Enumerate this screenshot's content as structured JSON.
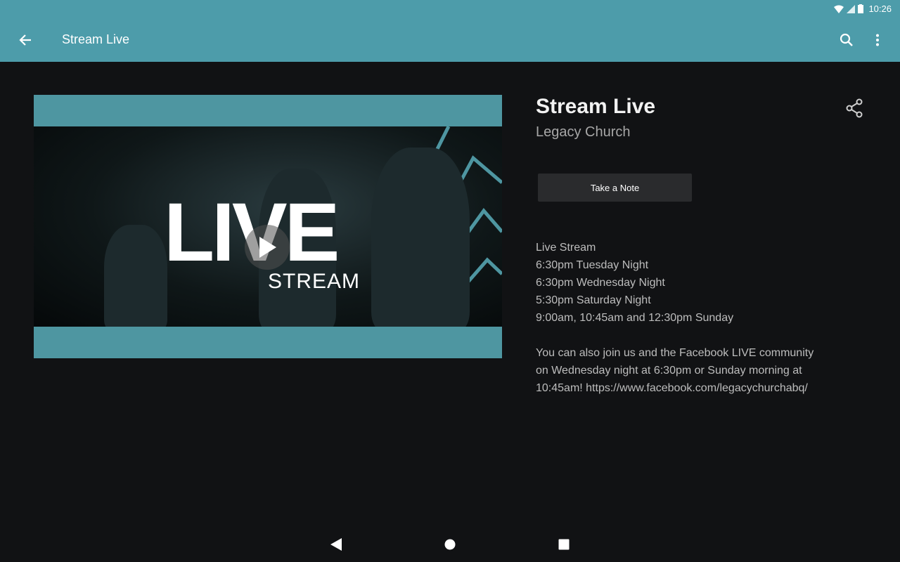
{
  "status_bar": {
    "time": "10:26"
  },
  "app_bar": {
    "title": "Stream Live"
  },
  "media": {
    "overlay_title": "LIVE",
    "overlay_subtitle": "STREAM"
  },
  "details": {
    "title": "Stream Live",
    "subtitle": "Legacy Church",
    "note_button": "Take a Note",
    "schedule": [
      "Live Stream",
      "6:30pm Tuesday Night",
      "6:30pm Wednesday Night",
      "5:30pm Saturday Night",
      "9:00am, 10:45am and 12:30pm Sunday"
    ],
    "paragraph_lines": [
      "You can also join us and the Facebook LIVE community",
      "on Wednesday night at 6:30pm or Sunday morning at",
      "10:45am! https://www.facebook.com/legacychurchabq/"
    ]
  },
  "icons": {
    "back": "arrow-left-icon",
    "search": "search-icon",
    "more": "more-vert-icon",
    "share": "share-icon",
    "play": "play-icon",
    "nav_back": "nav-back-icon",
    "nav_home": "nav-home-icon",
    "nav_recents": "nav-recents-icon"
  },
  "colors": {
    "accent": "#4d9caa",
    "background": "#111214",
    "button": "#2a2b2d"
  }
}
